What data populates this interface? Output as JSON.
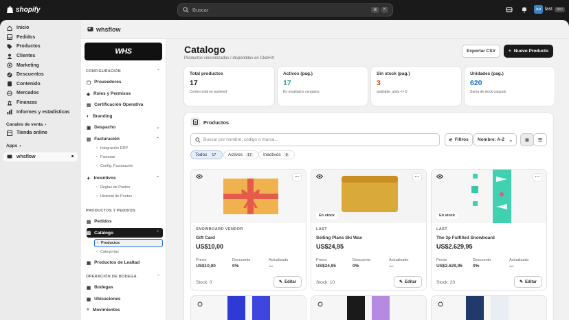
{
  "topbar": {
    "logo_text": "shopify",
    "search_placeholder": "Buscar",
    "shortcut_keys": [
      "⌘",
      "K"
    ],
    "store_avatar": "last",
    "store_name": "last",
    "store_badge": "dev"
  },
  "leftnav": {
    "items": [
      {
        "label": "Inicio",
        "icon": "home-icon"
      },
      {
        "label": "Pedidos",
        "icon": "inbox-icon"
      },
      {
        "label": "Productos",
        "icon": "tag-icon"
      },
      {
        "label": "Clientes",
        "icon": "person-icon"
      },
      {
        "label": "Marketing",
        "icon": "target-icon"
      },
      {
        "label": "Descuentos",
        "icon": "discount-icon"
      },
      {
        "label": "Contenido",
        "icon": "document-icon"
      },
      {
        "label": "Mercados",
        "icon": "globe-icon"
      },
      {
        "label": "Finanzas",
        "icon": "bank-icon"
      },
      {
        "label": "Informes y estadísticas",
        "icon": "chart-icon"
      }
    ],
    "sales_channels_label": "Canales de venta",
    "online_store_label": "Tienda online",
    "apps_label": "Apps",
    "app_item_label": "whsflow"
  },
  "app": {
    "title": "whsflow",
    "brand_text": "WHS",
    "sections": {
      "config": "CONFIGURACIÓN",
      "products_orders": "PRODUCTOS Y PEDIDOS",
      "warehouse_ops": "OPERACIÓN DE BODEGA"
    },
    "config_items": [
      "Proveedores",
      "Roles y Permisos",
      "Certificación Operativa",
      "Branding",
      "Despacho",
      "Facturación"
    ],
    "billing_sub": [
      "Integración ERP",
      "Facturas",
      "Config. Facturación"
    ],
    "incentives_label": "Incentivos",
    "incentives_sub": [
      "Reglas de Puntos",
      "Historial de Puntos"
    ],
    "orders_label": "Pedidos",
    "catalog_label": "Catálogo",
    "catalog_sub": [
      "Productos",
      "Categorías"
    ],
    "loyalty_label": "Productos de Lealtad",
    "warehouse_items": [
      "Bodegas",
      "Ubicaciones",
      "Movimientos"
    ]
  },
  "page": {
    "title": "Catalogo",
    "subtitle": "Productos sincronizados / disponibles en ClubHX",
    "export_label": "Exportar CSV",
    "new_label": "Nuevo Producto"
  },
  "kpis": [
    {
      "label": "Total productos",
      "value": "17",
      "hint": "Conteo total en backend",
      "color": "#1a1a1a"
    },
    {
      "label": "Activos (pag.)",
      "value": "17",
      "hint": "En resultados cargados",
      "color": "#2a9d8f"
    },
    {
      "label": "Sin stock (pag.)",
      "value": "3",
      "hint": "available_units <= 0",
      "color": "#d9480f"
    },
    {
      "label": "Unidades (pag.)",
      "value": "620",
      "hint": "Suma de stock cargado",
      "color": "#1971c2"
    }
  ],
  "products_panel": {
    "title": "Productos",
    "search_placeholder": "Buscar por nombre, codigo o marca...",
    "filters_label": "Filtros",
    "sort_label": "Nombre: A-Z",
    "tabs": [
      {
        "label": "Todos",
        "count": "17"
      },
      {
        "label": "Activos",
        "count": "17"
      },
      {
        "label": "Inactivos",
        "count": "0"
      }
    ],
    "meta_labels": {
      "price": "Precio",
      "discount": "Descuento",
      "updated": "Actualizado"
    },
    "edit_label": "Editar",
    "cards": [
      {
        "vendor": "SNOWBOARD VENDOR",
        "name": "Gift Card",
        "price": "US$10,00",
        "meta_price": "US$10,00",
        "discount": "0%",
        "updated": "—",
        "stock": "Stock: 0",
        "stock_badge": "",
        "image": "gift-card-image"
      },
      {
        "vendor": "LAST",
        "name": "Selling Plans Ski Wax",
        "price": "US$24,95",
        "meta_price": "US$24,95",
        "discount": "0%",
        "updated": "—",
        "stock": "Stock: 10",
        "stock_badge": "En stock",
        "image": "ski-wax-image"
      },
      {
        "vendor": "LAST",
        "name": "The 3p Fulfilled Snowboard",
        "price": "US$2.629,95",
        "meta_price": "US$2.629,95",
        "discount": "0%",
        "updated": "—",
        "stock": "Stock: 20",
        "stock_badge": "En stock",
        "image": "snowboard-image"
      }
    ]
  }
}
